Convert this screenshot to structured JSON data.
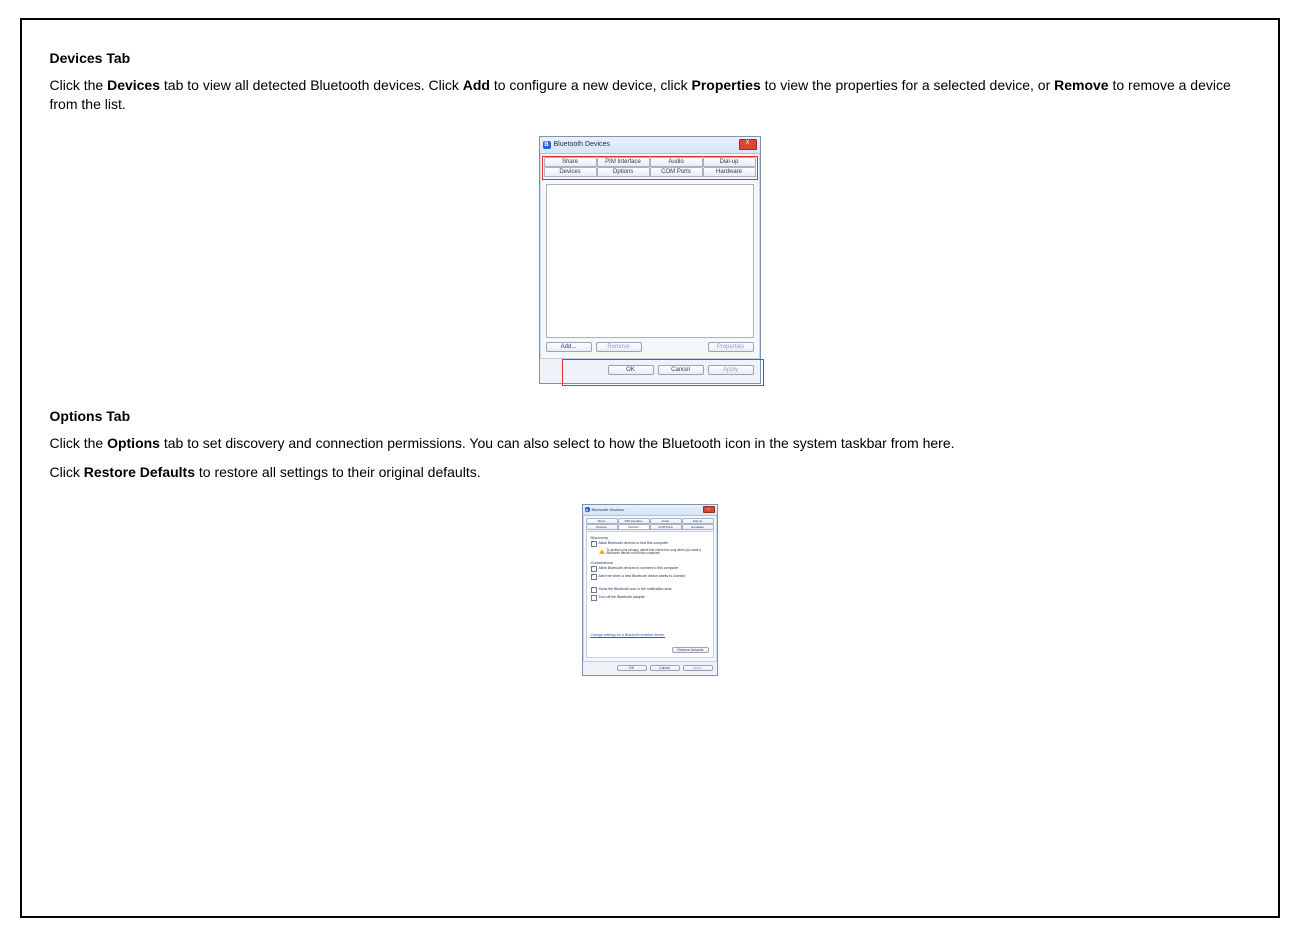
{
  "section1": {
    "heading": "Devices Tab",
    "para_parts": [
      "Click the ",
      "Devices",
      " tab to view all detected Bluetooth devices. Click ",
      "Add",
      " to configure a new device, click ",
      "Properties",
      " to view the properties for a selected device, or ",
      "Remove",
      " to remove a device from the list."
    ]
  },
  "dialog1": {
    "title": "Bluetooth Devices",
    "close": "X",
    "tabs_row1": [
      "Share",
      "PIM Interface",
      "Audio",
      "Dial-up"
    ],
    "tabs_row2": [
      "Devices",
      "Options",
      "COM Ports",
      "Hardware"
    ],
    "buttons": {
      "add": "Add...",
      "remove": "Remove",
      "properties": "Properties"
    },
    "footer": {
      "ok": "OK",
      "cancel": "Cancel",
      "apply": "Apply"
    }
  },
  "section2": {
    "heading": "Options Tab",
    "para1_parts": [
      "Click the ",
      "Options",
      " tab to set discovery and connection permissions. You can also select to how the Bluetooth icon in the system taskbar from here."
    ],
    "para2_parts": [
      "Click ",
      "Restore Defaults",
      " to restore all settings to their original defaults."
    ]
  },
  "dialog2": {
    "title": "Bluetooth Devices",
    "close": "X",
    "tabs_row1": [
      "Share",
      "PIM Interface",
      "Audio",
      "Dial-up"
    ],
    "tabs_row2": [
      "Devices",
      "Options",
      "COM Ports",
      "Hardware"
    ],
    "group_discovery": {
      "title": "Discovery",
      "check1": "Allow Bluetooth devices to find this computer",
      "warn": "To protect your privacy, select this check box only when you want a Bluetooth device to find this computer."
    },
    "group_connections": {
      "title": "Connections",
      "check1": "Allow Bluetooth devices to connect to this computer",
      "check2": "Alert me when a new Bluetooth device wants to connect"
    },
    "misc": {
      "check1": "Show the Bluetooth icon in the notification area",
      "check2": "Turn off the Bluetooth adapter"
    },
    "link": "Change settings for a Bluetooth enabled device.",
    "restore": "Restore Defaults",
    "footer": {
      "ok": "OK",
      "cancel": "Cancel",
      "apply": "Apply"
    }
  }
}
